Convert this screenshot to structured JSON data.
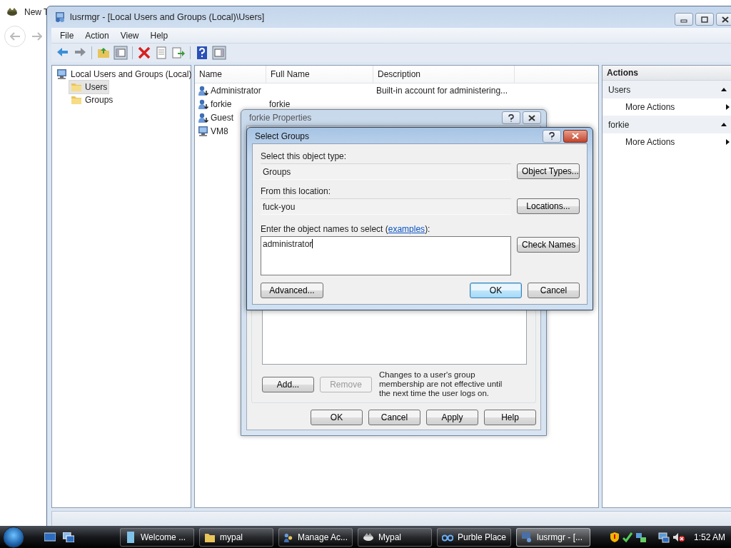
{
  "background_window": {
    "tab_title": "New T"
  },
  "window": {
    "title": "lusrmgr - [Local Users and Groups (Local)\\Users]"
  },
  "menu": [
    "File",
    "Action",
    "View",
    "Help"
  ],
  "tree": [
    {
      "label": "Local Users and Groups (Local)",
      "kind": "computer",
      "selected": false,
      "children": [
        {
          "label": "Users",
          "kind": "folder",
          "selected": true
        },
        {
          "label": "Groups",
          "kind": "folder",
          "selected": false
        }
      ]
    }
  ],
  "list": {
    "columns": [
      "Name",
      "Full Name",
      "Description"
    ],
    "rows": [
      {
        "kind": "user",
        "name": "Administrator",
        "description": "Built-in account for administering..."
      },
      {
        "kind": "user",
        "name": "forkie",
        "full_name": "forkie"
      },
      {
        "kind": "user",
        "name": "Guest"
      },
      {
        "kind": "computer",
        "name": "VM8"
      }
    ]
  },
  "actions": {
    "title": "Actions",
    "sections": [
      {
        "title": "Users",
        "expanded": true,
        "items": [
          "More Actions"
        ]
      },
      {
        "title": "forkie",
        "expanded": true,
        "items": [
          "More Actions"
        ]
      }
    ]
  },
  "properties_dialog": {
    "title": "forkie Properties",
    "buttons": [
      {
        "label": "Add...",
        "disabled": false
      },
      {
        "label": "Remove",
        "disabled": true
      }
    ],
    "note": "Changes to a user's group membership are not effective until the next time the user logs on.",
    "footer_buttons": [
      "OK",
      "Cancel",
      "Apply",
      "Help"
    ]
  },
  "select_dialog": {
    "title": "Select Groups",
    "object_type_label": "Select this object type:",
    "object_type": "Groups",
    "object_types_button": "Object Types...",
    "location_label": "From this location:",
    "location": "fuck-you",
    "locations_button": "Locations...",
    "names_label_start": "Enter the object names to select (",
    "names_link": "examples",
    "names_label_end": "):",
    "names_value": "administrator",
    "check_names_button": "Check Names",
    "advanced_button": "Advanced...",
    "buttons": [
      {
        "label": "OK",
        "default": true
      },
      {
        "label": "Cancel",
        "default": false
      }
    ]
  },
  "taskbar": {
    "items": [
      {
        "label": "Welcome ...",
        "selected": false
      },
      {
        "label": "mypal",
        "selected": false
      },
      {
        "label": "Manage Ac...",
        "selected": false
      },
      {
        "label": "Mypal",
        "selected": false
      },
      {
        "label": "Purble Place",
        "selected": false
      },
      {
        "label": "lusrmgr - [...",
        "selected": true
      }
    ],
    "clock": "1:52 AM"
  }
}
